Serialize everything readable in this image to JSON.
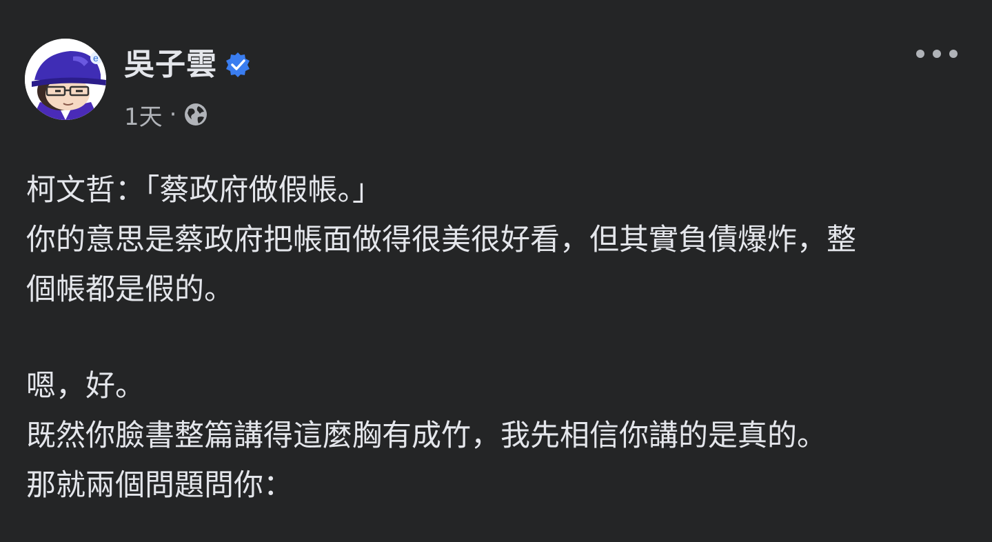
{
  "author": {
    "name": "吳子雲",
    "verified_icon": "verified-badge-icon",
    "verified_color": "#3a7df0"
  },
  "meta": {
    "time": "1天",
    "separator": "·",
    "audience_icon": "globe-icon"
  },
  "actions": {
    "more_icon": "more-options-icon"
  },
  "post": {
    "lines": [
      "柯文哲：「蔡政府做假帳。」",
      "你的意思是蔡政府把帳面做得很美很好看，但其實負債爆炸，整",
      "個帳都是假的。",
      "嗯，好。",
      "既然你臉書整篇講得這麼胸有成竹，我先相信你講的是真的。",
      "那就兩個問題問你："
    ]
  },
  "colors": {
    "background": "#242526",
    "text_primary": "#e4e6eb",
    "text_secondary": "#b0b3b8"
  }
}
